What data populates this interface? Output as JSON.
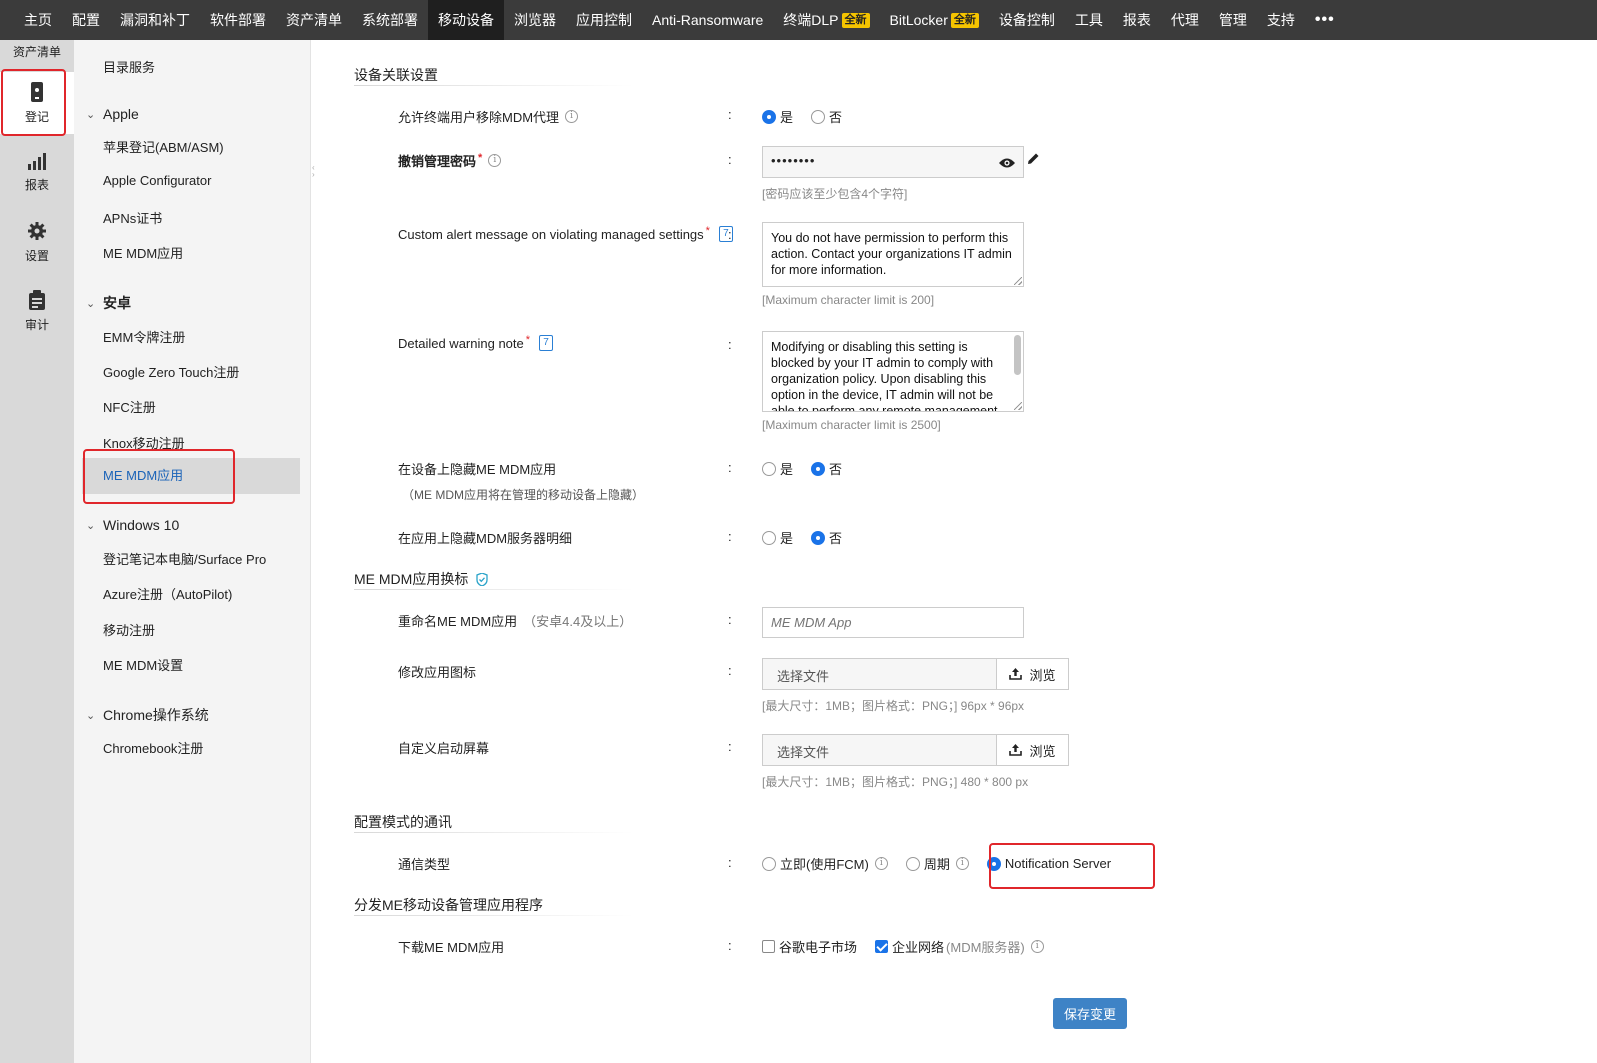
{
  "topnav": {
    "items": [
      "主页",
      "配置",
      "漏洞和补丁",
      "软件部署",
      "资产清单",
      "系统部署",
      "移动设备",
      "浏览器",
      "应用控制",
      "Anti-Ransomware",
      "终端DLP",
      "BitLocker",
      "设备控制",
      "工具",
      "报表",
      "代理",
      "管理",
      "支持"
    ],
    "new_badge": "全新",
    "more": "•••"
  },
  "rail": {
    "top_label": "资产清单",
    "items": [
      "登记",
      "报表",
      "设置",
      "审计"
    ]
  },
  "sidebar": {
    "top_item": "目录服务",
    "groups": [
      {
        "title": "Apple",
        "items": [
          "苹果登记(ABM/ASM)",
          "Apple Configurator",
          "APNs证书",
          "ME MDM应用"
        ]
      },
      {
        "title": "安卓",
        "items": [
          "EMM令牌注册",
          "Google Zero Touch注册",
          "NFC注册",
          "Knox移动注册",
          "ME MDM应用"
        ]
      },
      {
        "title": "Windows 10",
        "items": [
          "登记笔记本电脑/Surface Pro",
          "Azure注册（AutoPilot)",
          "移动注册",
          "ME MDM设置"
        ]
      },
      {
        "title": "Chrome操作系统",
        "items": [
          "Chromebook注册"
        ]
      }
    ]
  },
  "main": {
    "section1": "设备关联设置",
    "allow_remove": {
      "label": "允许终端用户移除MDM代理",
      "yes": "是",
      "no": "否"
    },
    "revoke_pw": {
      "label": "撤销管理密码",
      "value": "••••••••",
      "hint": "[密码应该至少包含4个字符]"
    },
    "alert_msg": {
      "label": "Custom alert message on violating managed settings",
      "doc": "7",
      "value": "You do not have permission to perform this action. Contact your organizations IT admin for more information.",
      "hint": "[Maximum character limit is 200]"
    },
    "warning_note": {
      "label": "Detailed warning note",
      "doc": "7",
      "value": "Modifying or disabling this setting is blocked by your IT admin to comply with organization policy. Upon disabling this option in the device, IT admin will not be able to perform any remote management",
      "hint": "[Maximum character limit is 2500]"
    },
    "hide_app": {
      "label": "在设备上隐藏ME MDM应用",
      "sub": "（ME MDM应用将在管理的移动设备上隐藏）",
      "yes": "是",
      "no": "否"
    },
    "hide_server": {
      "label": "在应用上隐藏MDM服务器明细",
      "yes": "是",
      "no": "否"
    },
    "section2": "ME MDM应用换标",
    "rename": {
      "label": "重命名ME MDM应用",
      "note": "（安卓4.4及以上）",
      "placeholder": "ME MDM App"
    },
    "icon": {
      "label": "修改应用图标",
      "file": "选择文件",
      "browse": "浏览",
      "hint": "[最大尺寸：1MB；图片格式：PNG；] 96px * 96px"
    },
    "splash": {
      "label": "自定义启动屏幕",
      "file": "选择文件",
      "browse": "浏览",
      "hint": "[最大尺寸：1MB；图片格式：PNG；] 480 * 800 px"
    },
    "section3": "配置模式的通讯",
    "comm": {
      "label": "通信类型",
      "opt1": "立即(使用FCM)",
      "opt2": "周期",
      "opt3": "Notification Server"
    },
    "section4": "分发ME移动设备管理应用程序",
    "download": {
      "label": "下载ME MDM应用",
      "opt1": "谷歌电子市场",
      "opt2": "企业网络",
      "opt2_note": "(MDM服务器)"
    },
    "save": "保存变更"
  },
  "colors": {
    "accent": "#1a73e8",
    "highlight": "#e0262b",
    "nav_bg": "#3b3b3b",
    "save_bg": "#3e83c6"
  }
}
